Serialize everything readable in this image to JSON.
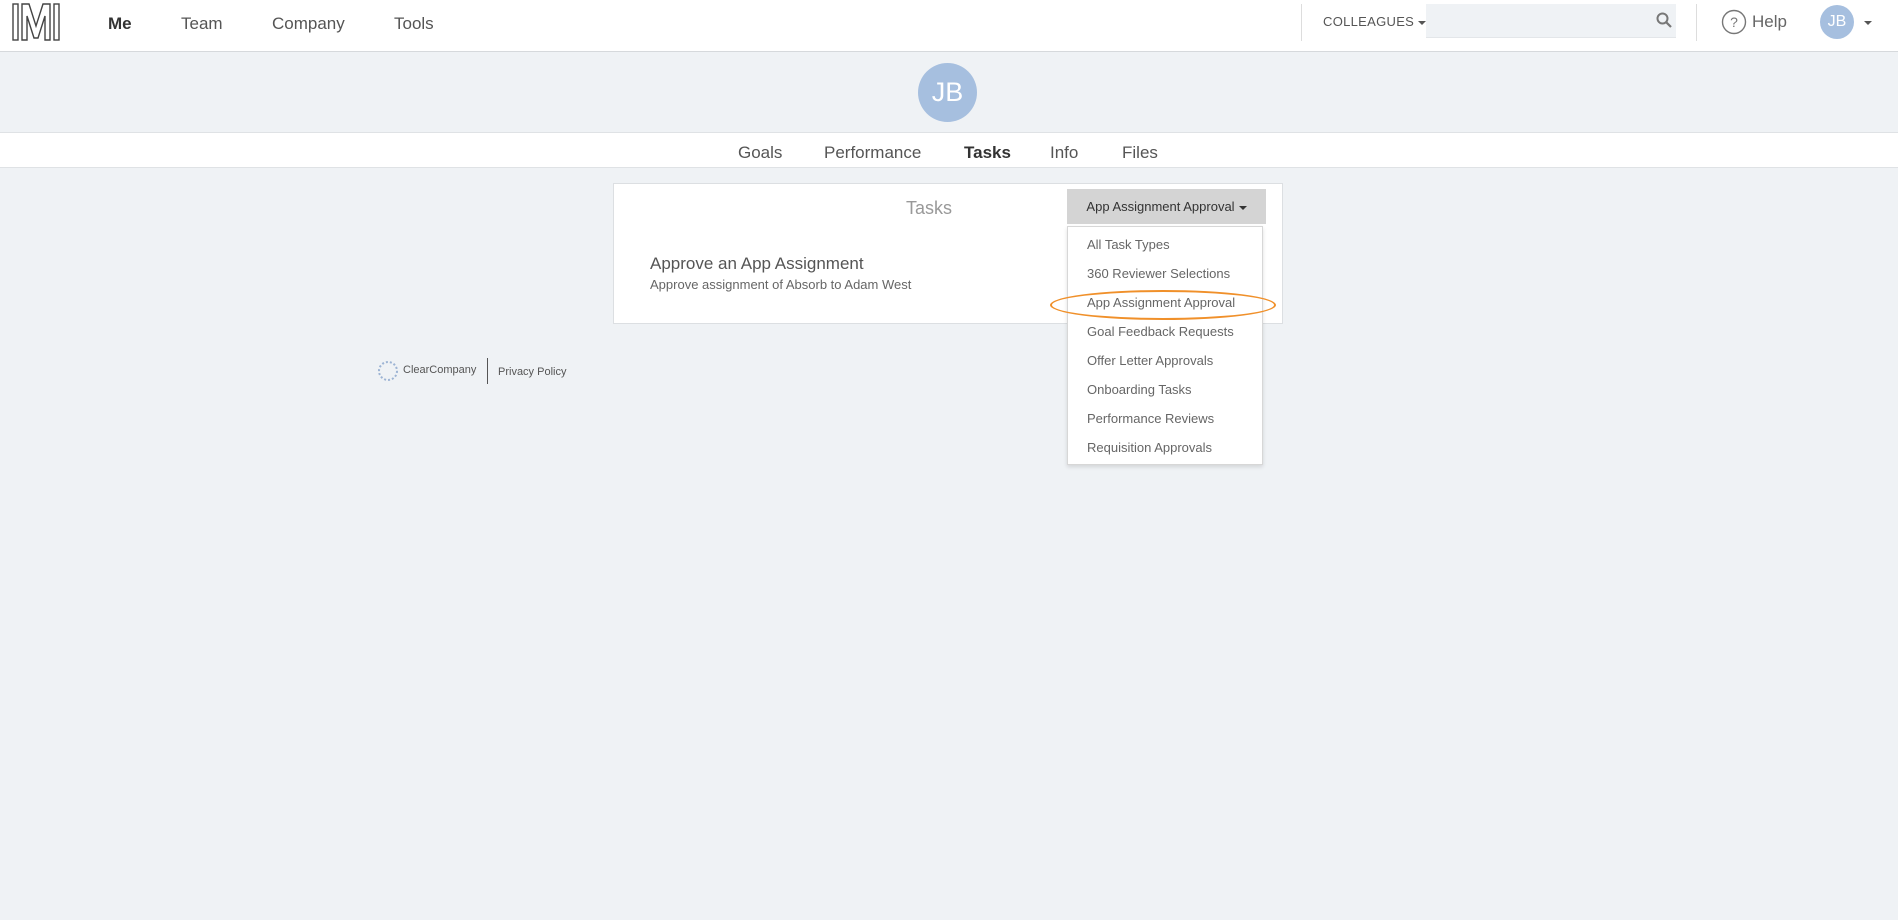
{
  "topnav": {
    "links": [
      "Me",
      "Team",
      "Company",
      "Tools"
    ],
    "active": "Me",
    "colleagues_label": "COLLEAGUES",
    "search_value": "",
    "help_label": "Help",
    "user_initials": "JB"
  },
  "profile": {
    "initials": "JB",
    "tabs": [
      "Goals",
      "Performance",
      "Tasks",
      "Info",
      "Files"
    ],
    "active_tab": "Tasks"
  },
  "tasks_panel": {
    "title": "Tasks",
    "filter_selected": "App Assignment Approval",
    "filter_options": [
      "All Task Types",
      "360 Reviewer Selections",
      "App Assignment Approval",
      "Goal Feedback Requests",
      "Offer Letter Approvals",
      "Onboarding Tasks",
      "Performance Reviews",
      "Requisition Approvals"
    ],
    "highlight_color": "#f0902a",
    "items": [
      {
        "title": "Approve an App Assignment",
        "description": "Approve assignment of Absorb to Adam West"
      }
    ]
  },
  "footer": {
    "brand": "ClearCompany",
    "privacy_link": "Privacy Policy"
  },
  "colors": {
    "page_bg": "#eff2f5",
    "avatar_bg": "#a6bfdf",
    "button_bg": "#d4d4d4"
  }
}
